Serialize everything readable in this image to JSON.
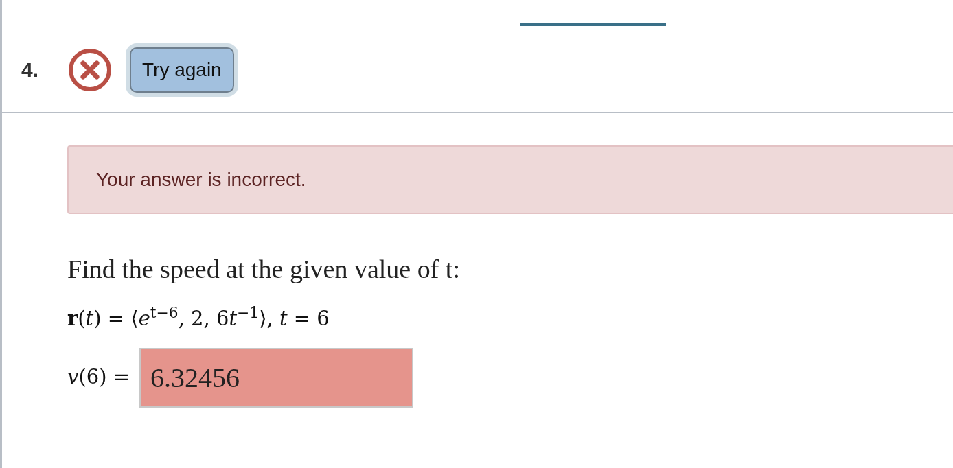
{
  "question": {
    "number": "4.",
    "incorrect": true,
    "action": "Try again"
  },
  "alert": {
    "message": "Your answer is incorrect."
  },
  "prompt": "Find the speed at the given value of t:",
  "formula": [
    "**r**(*t*) = ⟨*e*$^{t−6}$, 2, 6",
    "*t*$^{−1}$⟩, *t* = 6"
  ],
  "answer": {
    "label": "*v*(6) =",
    "value": "6.32456",
    "correct": false
  }
}
